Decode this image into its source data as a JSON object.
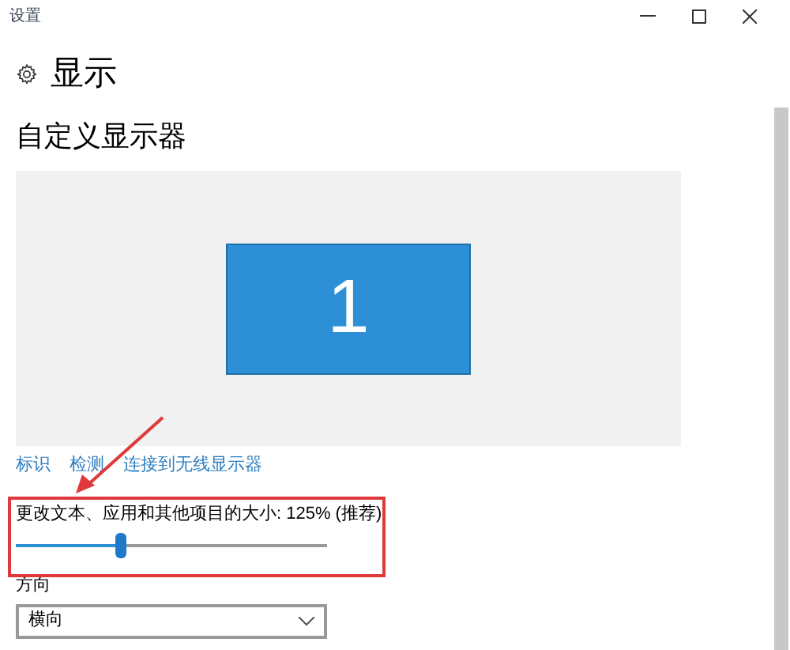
{
  "window": {
    "title": "设置"
  },
  "page": {
    "title": "显示"
  },
  "section": {
    "title": "自定义显示器"
  },
  "monitors": [
    {
      "label": "1",
      "selected": true
    }
  ],
  "links": [
    "标识",
    "检测",
    "连接到无线显示器"
  ],
  "scale": {
    "label": "更改文本、应用和其他项目的大小: 125% (推荐)",
    "level": 0.335
  },
  "orientation": {
    "label": "方向",
    "value": "横向"
  }
}
